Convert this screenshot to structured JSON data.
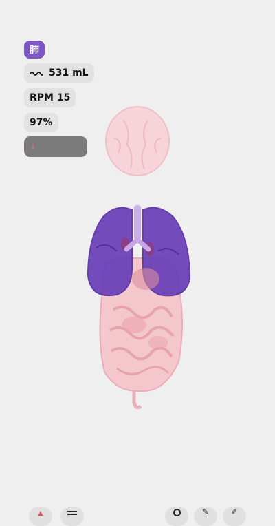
{
  "organ_badge": {
    "label": "肺",
    "color": "#7c55c7"
  },
  "metrics": {
    "tidal_volume": "531 mL",
    "tidal_icon": "wave-icon",
    "respiratory_rate": "RPM 15",
    "oxygen_saturation": "97%"
  },
  "trend": {
    "icon": "arrow-down-icon",
    "color": "#d96b7d"
  },
  "bottom_toolbar": {
    "items": [
      {
        "name": "heart-icon"
      },
      {
        "name": "menu-icon"
      },
      {
        "name": "pin-icon"
      },
      {
        "name": "pencil-icon"
      },
      {
        "name": "brush-icon"
      }
    ]
  },
  "colors": {
    "background": "#efefef",
    "lungs": "#6a3fb8",
    "organs": "#f2c9cf",
    "accent": "#7c55c7"
  }
}
